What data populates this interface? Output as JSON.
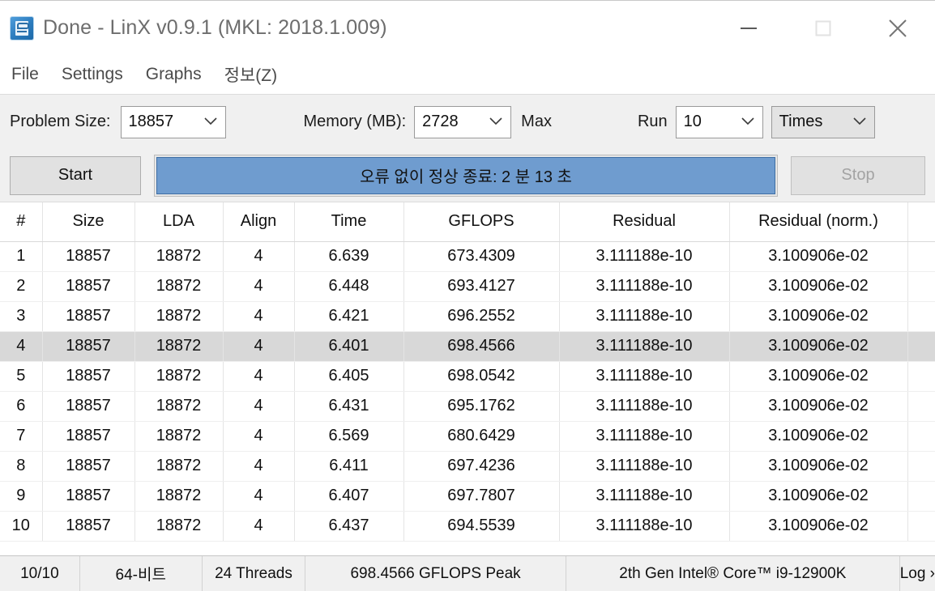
{
  "window": {
    "title": "Done - LinX v0.9.1 (MKL: 2018.1.009)",
    "app_icon": "linx-app-icon",
    "controls": {
      "minimize": "minimize-icon",
      "maximize": "maximize-icon",
      "close": "close-icon"
    }
  },
  "menubar": {
    "items": [
      {
        "label": "File"
      },
      {
        "label": "Settings"
      },
      {
        "label": "Graphs"
      },
      {
        "label": "정보(Z)"
      }
    ]
  },
  "toolbar": {
    "problem_size_label": "Problem Size:",
    "problem_size_value": "18857",
    "memory_label": "Memory (MB):",
    "memory_value": "2728",
    "max_label": "Max",
    "run_label": "Run",
    "run_value": "10",
    "times_value": "Times"
  },
  "actions": {
    "start_label": "Start",
    "stop_label": "Stop",
    "progress_text": "오류 없이 정상 종료: 2 분 13 초",
    "progress_percent": 100,
    "progress_color": "#6f9ccf"
  },
  "table": {
    "headers": [
      "#",
      "Size",
      "LDA",
      "Align",
      "Time",
      "GFLOPS",
      "Residual",
      "Residual (norm.)",
      ""
    ],
    "selected_row_index": 3,
    "rows": [
      [
        "1",
        "18857",
        "18872",
        "4",
        "6.639",
        "673.4309",
        "3.111188e-10",
        "3.100906e-02",
        ""
      ],
      [
        "2",
        "18857",
        "18872",
        "4",
        "6.448",
        "693.4127",
        "3.111188e-10",
        "3.100906e-02",
        ""
      ],
      [
        "3",
        "18857",
        "18872",
        "4",
        "6.421",
        "696.2552",
        "3.111188e-10",
        "3.100906e-02",
        ""
      ],
      [
        "4",
        "18857",
        "18872",
        "4",
        "6.401",
        "698.4566",
        "3.111188e-10",
        "3.100906e-02",
        ""
      ],
      [
        "5",
        "18857",
        "18872",
        "4",
        "6.405",
        "698.0542",
        "3.111188e-10",
        "3.100906e-02",
        ""
      ],
      [
        "6",
        "18857",
        "18872",
        "4",
        "6.431",
        "695.1762",
        "3.111188e-10",
        "3.100906e-02",
        ""
      ],
      [
        "7",
        "18857",
        "18872",
        "4",
        "6.569",
        "680.6429",
        "3.111188e-10",
        "3.100906e-02",
        ""
      ],
      [
        "8",
        "18857",
        "18872",
        "4",
        "6.411",
        "697.4236",
        "3.111188e-10",
        "3.100906e-02",
        ""
      ],
      [
        "9",
        "18857",
        "18872",
        "4",
        "6.407",
        "697.7807",
        "3.111188e-10",
        "3.100906e-02",
        ""
      ],
      [
        "10",
        "18857",
        "18872",
        "4",
        "6.437",
        "694.5539",
        "3.111188e-10",
        "3.100906e-02",
        ""
      ]
    ]
  },
  "statusbar": {
    "runs": "10/10",
    "bitness": "64-비트",
    "threads": "24 Threads",
    "peak": "698.4566 GFLOPS Peak",
    "cpu": "2th Gen Intel® Core™ i9-12900K",
    "log": "Log ›"
  }
}
